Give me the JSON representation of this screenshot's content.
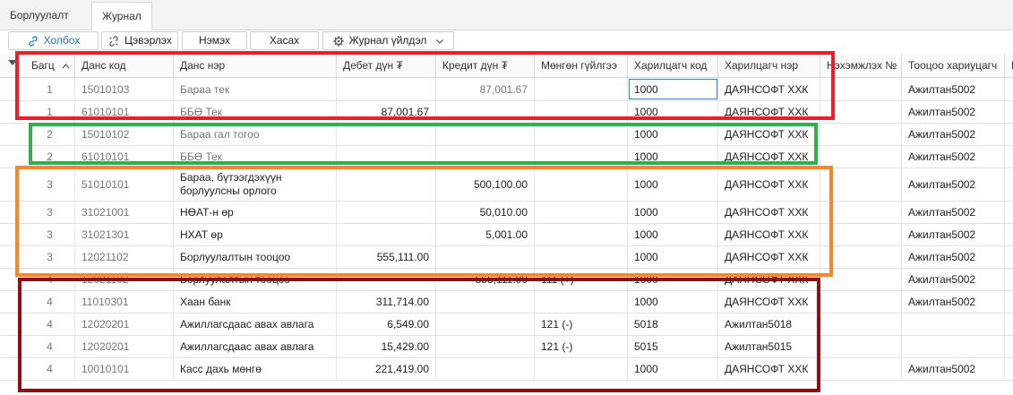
{
  "tabs": [
    {
      "label": "Борлуулалт",
      "active": false
    },
    {
      "label": "Журнал",
      "active": true
    }
  ],
  "toolbar": {
    "link_label": "Холбох",
    "unlink_label": "Цэвэрлэх",
    "add_label": "Нэмэх",
    "remove_label": "Хасах",
    "journal_action_label": "Журнал үйлдэл"
  },
  "columns": [
    "Багц",
    "Данс код",
    "Данс нэр",
    "Дебет дүн ₮",
    "Кредит дүн ₮",
    "Мөнгөн гүйлгээ",
    "Харилцагч код",
    "Харилцагч нэр",
    "Нэхэмжлэх №",
    "Тооцоо хариуцагч",
    "П"
  ],
  "rows": [
    {
      "batch": "1",
      "code": "15010103",
      "name": "Бараа тек",
      "debit": "",
      "credit": "87,001.67",
      "cash": "",
      "partner_code": "1000",
      "partner_name": "ДАЯНСОФТ ХХК",
      "invoice": "",
      "responsible": "Ажилтан5002"
    },
    {
      "batch": "1",
      "code": "61010101",
      "name": "ББӨ Тек",
      "debit": "87,001.67",
      "credit": "",
      "cash": "",
      "partner_code": "1000",
      "partner_name": "ДАЯНСОФТ ХХК",
      "invoice": "",
      "responsible": "Ажилтан5002"
    },
    {
      "batch": "2",
      "code": "15010102",
      "name": "Бараа гал тогоо",
      "debit": "",
      "credit": "",
      "cash": "",
      "partner_code": "1000",
      "partner_name": "ДАЯНСОФТ ХХК",
      "invoice": "",
      "responsible": "Ажилтан5002"
    },
    {
      "batch": "2",
      "code": "61010101",
      "name": "ББӨ Тек",
      "debit": "",
      "credit": "",
      "cash": "",
      "partner_code": "1000",
      "partner_name": "ДАЯНСОФТ ХХК",
      "invoice": "",
      "responsible": "Ажилтан5002"
    },
    {
      "batch": "3",
      "code": "51010101",
      "name": "Бараа, бүтээгдэхүүн борлуулсны орлого",
      "debit": "",
      "credit": "500,100.00",
      "cash": "",
      "partner_code": "1000",
      "partner_name": "ДАЯНСОФТ ХХК",
      "invoice": "",
      "responsible": "Ажилтан5002"
    },
    {
      "batch": "3",
      "code": "31021001",
      "name": "НӨАТ-н өр",
      "debit": "",
      "credit": "50,010.00",
      "cash": "",
      "partner_code": "1000",
      "partner_name": "ДАЯНСОФТ ХХК",
      "invoice": "",
      "responsible": "Ажилтан5002"
    },
    {
      "batch": "3",
      "code": "31021301",
      "name": "НХАТ өр",
      "debit": "",
      "credit": "5,001.00",
      "cash": "",
      "partner_code": "1000",
      "partner_name": "ДАЯНСОФТ ХХК",
      "invoice": "",
      "responsible": "Ажилтан5002"
    },
    {
      "batch": "3",
      "code": "12021102",
      "name": "Борлуулалтын тооцоо",
      "debit": "555,111.00",
      "credit": "",
      "cash": "",
      "partner_code": "1000",
      "partner_name": "ДАЯНСОФТ ХХК",
      "invoice": "",
      "responsible": "Ажилтан5002"
    },
    {
      "batch": "4",
      "code": "12021102",
      "name": "Борлуулалтын тооцоо",
      "debit": "",
      "credit": "555,111.00",
      "cash": "111 (+)",
      "partner_code": "1000",
      "partner_name": "ДАЯНСОФТ ХХК",
      "invoice": "",
      "responsible": "Ажилтан5002"
    },
    {
      "batch": "4",
      "code": "11010301",
      "name": "Хаан банк",
      "debit": "311,714.00",
      "credit": "",
      "cash": "",
      "partner_code": "1000",
      "partner_name": "ДАЯНСОФТ ХХК",
      "invoice": "",
      "responsible": "Ажилтан5002"
    },
    {
      "batch": "4",
      "code": "12020201",
      "name": "Ажиллагсдаас авах авлага",
      "debit": "6,549.00",
      "credit": "",
      "cash": "121 (-)",
      "partner_code": "5018",
      "partner_name": "Ажилтан5018",
      "invoice": "",
      "responsible": ""
    },
    {
      "batch": "4",
      "code": "12020201",
      "name": "Ажиллагсдаас авах авлага",
      "debit": "15,429.00",
      "credit": "",
      "cash": "121 (-)",
      "partner_code": "5015",
      "partner_name": "Ажилтан5015",
      "invoice": "",
      "responsible": ""
    },
    {
      "batch": "4",
      "code": "10010101",
      "name": "Касс дахь мөнгө",
      "debit": "221,419.00",
      "credit": "",
      "cash": "",
      "partner_code": "1000",
      "partner_name": "ДАЯНСОФТ ХХК",
      "invoice": "",
      "responsible": "Ажилтан5002"
    }
  ],
  "colors": {
    "batch1": "#e8202a",
    "batch2": "#2fb04a",
    "batch3": "#f5862a",
    "batch4": "#8b0f14",
    "accent": "#1a73c7"
  }
}
